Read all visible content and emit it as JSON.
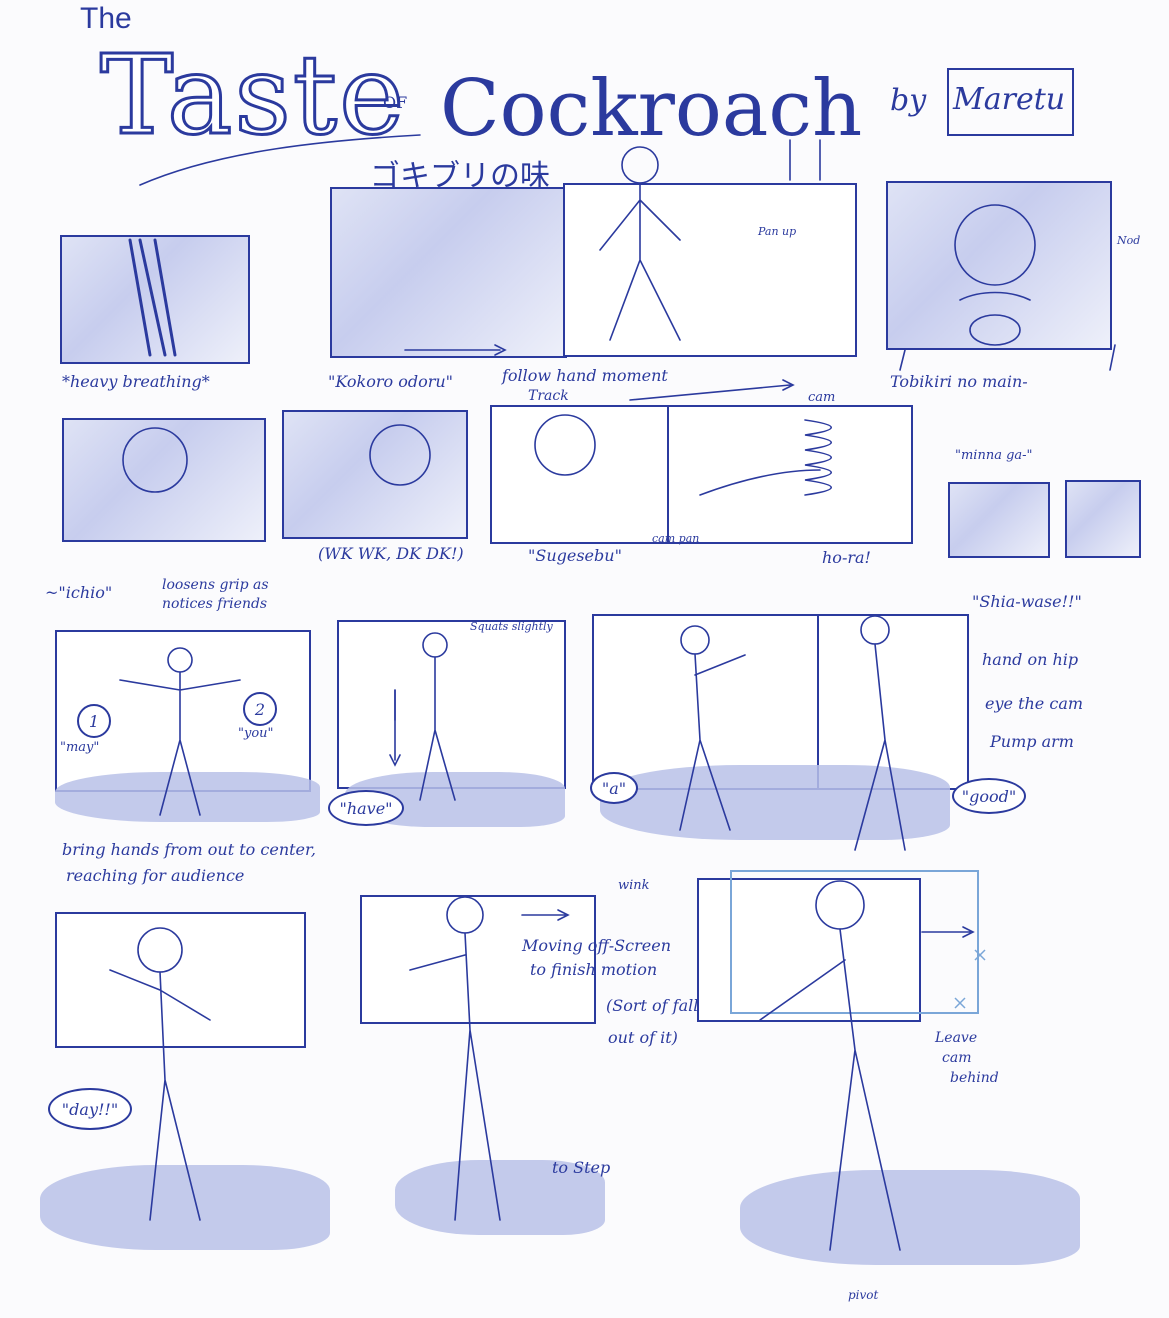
{
  "title": {
    "the": "The",
    "taste": "Taste",
    "of": "OF",
    "cockroach": "Cockroach",
    "japanese": "ゴキブリの味",
    "by": "by",
    "author": "Maretu"
  },
  "row1": {
    "caption_1": "*heavy breathing*",
    "caption_2": "\"Kokoro odoru\"",
    "caption_3_a": "follow hand moment",
    "caption_3_b": "Track",
    "caption_4": "Tobikiri no main-",
    "note_pan_up": "Pan up",
    "note_nod": "Nod"
  },
  "row2": {
    "caption_1": "~\"ichio\"",
    "caption_1b_a": "loosens grip as",
    "caption_1b_b": "notices friends",
    "caption_2": "(WK WK, DK DK!)",
    "caption_3": "\"Sugesebu\"",
    "note_cam_pan": "cam pan",
    "note_cam": "cam",
    "caption_4": "ho-ra!",
    "caption_5": "\"minna ga-\"",
    "caption_6": "\"Shia-wase!!\""
  },
  "row3": {
    "num_1": "1",
    "num_2": "2",
    "word_may": "\"may\"",
    "word_you": "\"you\"",
    "note_squats": "Squats slightly",
    "bubble_have": "\"have\"",
    "bubble_a": "\"a\"",
    "bubble_good": "\"good\"",
    "note_right_1": "hand on hip",
    "note_right_2": "eye the cam",
    "note_right_3": "Pump arm",
    "caption_a": "bring hands from out to center,",
    "caption_b": "reaching for audience"
  },
  "row4": {
    "note_wink": "wink",
    "bubble_day": "\"day!!\"",
    "note_moving_a": "Moving off-Screen",
    "note_moving_b": "to finish motion",
    "note_sortof_a": "(Sort of fall",
    "note_sortof_b": "out of it)",
    "note_step": "to Step",
    "note_leave_a": "Leave",
    "note_leave_b": "cam",
    "note_leave_c": "behind",
    "note_pivot": "pivot"
  }
}
